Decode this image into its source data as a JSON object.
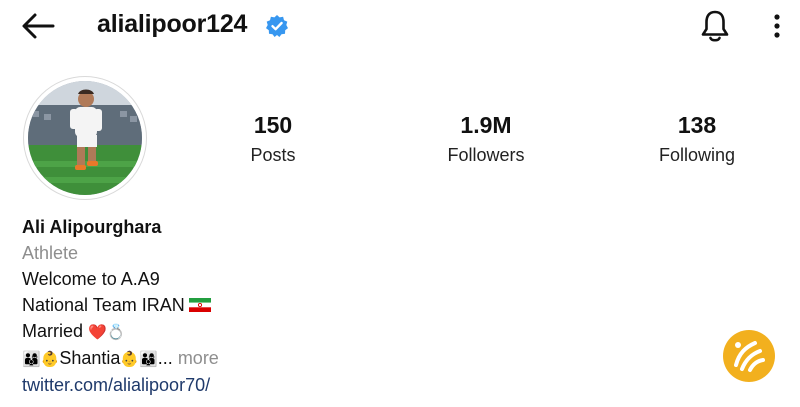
{
  "header": {
    "username": "alialipoor124",
    "icons": {
      "back": "arrow-left-icon",
      "verified": "verified-badge-icon",
      "notifications": "bell-icon",
      "more": "more-vertical-icon"
    },
    "verified_color": "#3797f0"
  },
  "stats": [
    {
      "value": "150",
      "label": "Posts"
    },
    {
      "value": "1.9M",
      "label": "Followers"
    },
    {
      "value": "138",
      "label": "Following"
    }
  ],
  "bio": {
    "display_name": "Ali Alipourghara",
    "category": "Athlete",
    "lines": [
      "Welcome to A.A9",
      "National Team IRAN"
    ],
    "married_text": "Married",
    "married_emojis": "❤️💍",
    "family_prefix_emojis": "👨‍👩‍👦👶",
    "family_name": "Shantia",
    "family_suffix_emojis": "👶👨‍👩‍👦",
    "ellipsis": "...",
    "more_label": "more",
    "link": "twitter.com/alialipoor70/"
  },
  "colors": {
    "accent": "#3797f0",
    "muted": "#8e8e8e",
    "link": "#1f3a6b",
    "watermark": "#f2b01e"
  }
}
